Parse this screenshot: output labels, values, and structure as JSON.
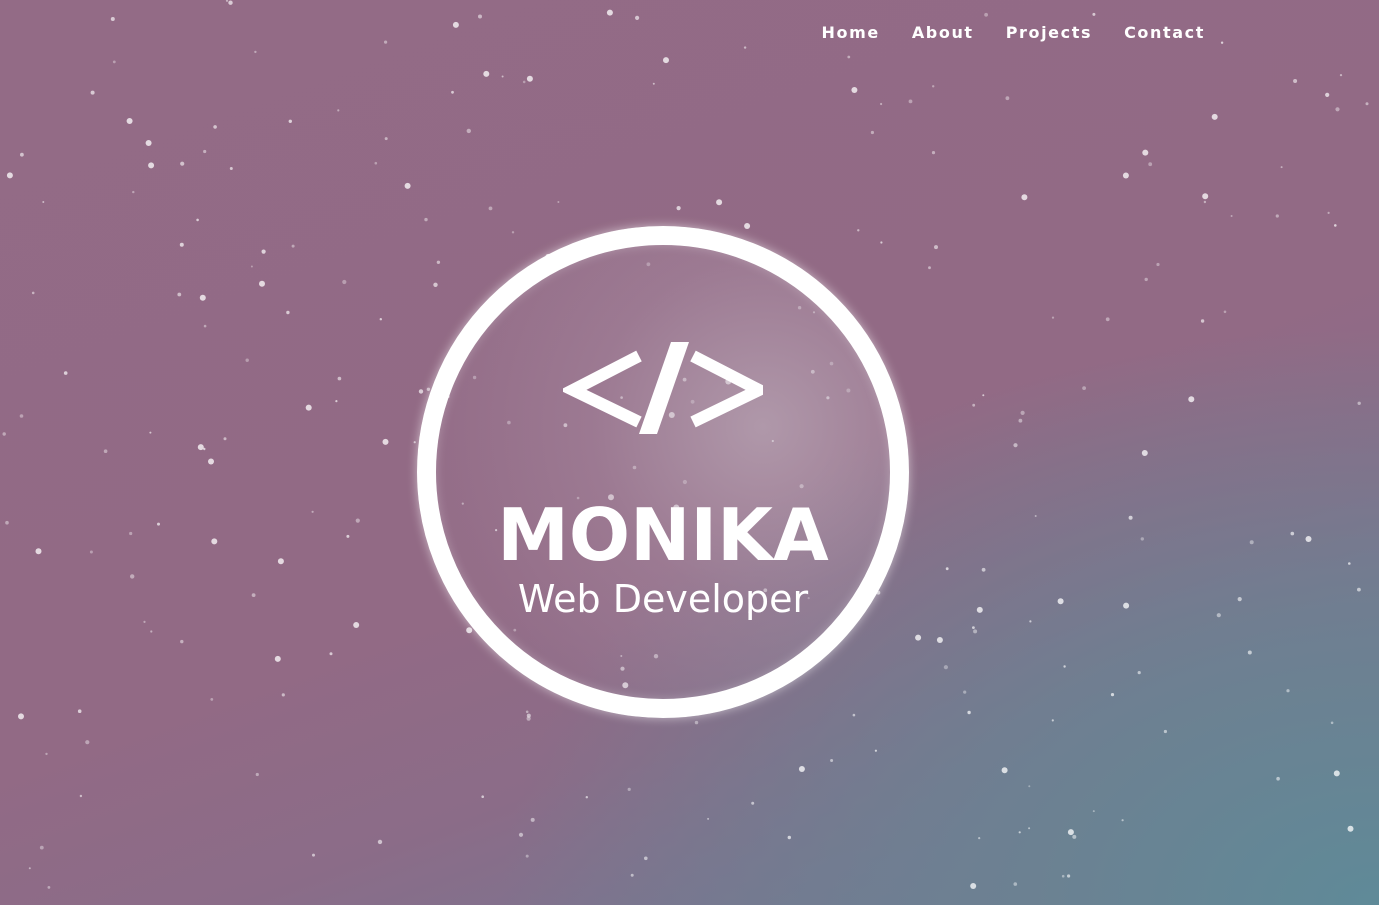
{
  "nav": {
    "items": [
      {
        "label": "Home"
      },
      {
        "label": "About"
      },
      {
        "label": "Projects"
      },
      {
        "label": "Contact"
      }
    ]
  },
  "hero": {
    "logo_icon": "code-brackets-icon",
    "name": "MONIKA",
    "subtitle": "Web Developer"
  },
  "colors": {
    "background_primary": "#936b86",
    "background_secondary": "#5f8a98",
    "text": "#ffffff"
  }
}
